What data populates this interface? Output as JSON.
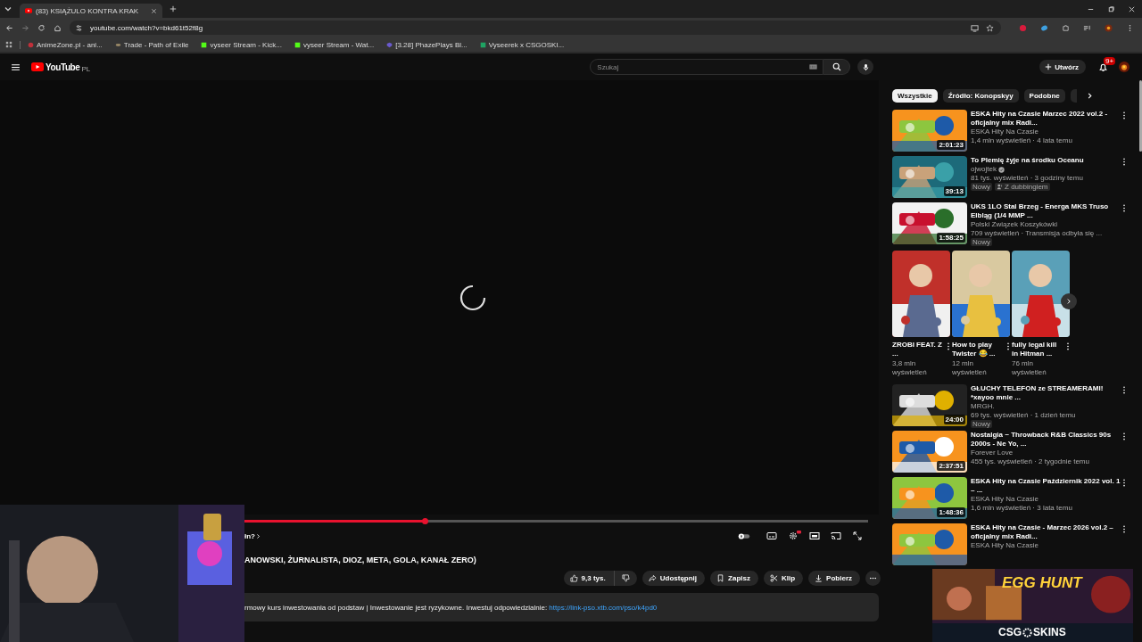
{
  "browser": {
    "tabs": [
      {
        "title": "(83) KSIĄŻULO KONTRA KRAK",
        "selected": true
      }
    ],
    "url": "youtube.com/watch?v=bkd61t52f8g",
    "bookmarks": [
      "AnimeZone.pl - ani...",
      "Trade - Path of Exile",
      "vyseer Stream - Kick...",
      "vyseer Stream - Wat...",
      "[3.28] PhazePlays Bl...",
      "Vyseerek x CSGOSKI..."
    ]
  },
  "header": {
    "logo": "YouTube",
    "region": "PL",
    "search": {
      "placeholder": "Szukaj"
    },
    "create": "Utwórz",
    "notifications": "9+"
  },
  "player": {
    "progress": {
      "level": 0.29
    },
    "chapter": "łn?",
    "title": "ANOWSKI, ŻURNALISTA, DIOZ, META, GOLA, KANAŁ ZERO)",
    "actions": {
      "likes": "9,3 tys.",
      "share": "Udostępnij",
      "save": "Zapisz",
      "clip": "Klip",
      "download": "Pobierz"
    },
    "description": {
      "text": "rmowy kurs inwestowania od podstaw | Inwestowanie jest ryzykowne. Inwestuj odpowiedzialnie:",
      "link": "https://link-pso.xtb.com/pso/k4pd0"
    }
  },
  "sidebar": {
    "chips": [
      {
        "label": "Wszystkie",
        "selected": true
      },
      {
        "label": "Źródło: Konopskyy",
        "selected": false
      },
      {
        "label": "Podobne",
        "selected": false
      }
    ],
    "items": [
      {
        "kind": "video",
        "title": "ESKA Hity na Czasie Marzec 2022 vol.2 - oficjalny mix Radi...",
        "channel": "ESKA Hity Na Czasie",
        "verified": false,
        "meta": "1,4 mln wyświetleń · 4 lata temu",
        "duration": "2:01:23"
      },
      {
        "kind": "video",
        "title": "To Plemię żyje na środku Oceanu",
        "channel": "ojwojtek",
        "verified": true,
        "meta": "81 tys. wyświetleń · 3 godziny temu",
        "duration": "39:13",
        "badges": [
          {
            "kind": "new",
            "label": "Nowy"
          },
          {
            "kind": "dub",
            "label": "Z dubbingiem"
          }
        ]
      },
      {
        "kind": "video",
        "title": "UKS 1LO Stal Brzeg - Energa MKS Truso Elbląg (1/4 MMP ...",
        "channel": "Polski Związek Koszykówki",
        "verified": false,
        "meta": "709 wyświetleń · Transmisja odbyła się ...",
        "duration": "1:58:25",
        "badges": [
          {
            "kind": "new",
            "label": "Nowy"
          }
        ]
      },
      {
        "kind": "shorts",
        "shorts": [
          {
            "title": "ZROBI FEAT. Z ...",
            "views": "3,8 mln wyświetleń"
          },
          {
            "title": "How to play Twister 😂 ...",
            "views": "12 mln wyświetleń"
          },
          {
            "title": "fully legal kill in Hitman ...",
            "views": "76 mln wyświetleń"
          }
        ]
      },
      {
        "kind": "video",
        "title": "GŁUCHY TELEFON ze STREAMERAMI! *xayoo mnie ...",
        "channel": "MRGH.",
        "verified": false,
        "meta": "69 tys. wyświetleń · 1 dzień temu",
        "duration": "24:00",
        "badges": [
          {
            "kind": "new",
            "label": "Nowy"
          }
        ]
      },
      {
        "kind": "video",
        "title": "Nostalgia ~ Throwback R&B Classics 90s 2000s - Ne Yo, ...",
        "channel": "Forever Love",
        "verified": false,
        "meta": "455 tys. wyświetleń · 2 tygodnie temu",
        "duration": "2:37:51"
      },
      {
        "kind": "video",
        "title": "ESKA Hity na Czasie Październik 2022 vol. 1 – ...",
        "channel": "ESKA Hity Na Czasie",
        "verified": false,
        "meta": "1,6 mln wyświetleń · 3 lata temu",
        "duration": "1:48:36"
      },
      {
        "kind": "video",
        "title": "ESKA Hity na Czasie - Marzec 2026 vol.2 – oficjalny mix Radi...",
        "channel": "ESKA Hity Na Czasie",
        "verified": false
      }
    ]
  },
  "overlay_ad": {
    "headline": "EGG HUNT",
    "brand_left": "CSG",
    "brand_right": "SKINS"
  }
}
